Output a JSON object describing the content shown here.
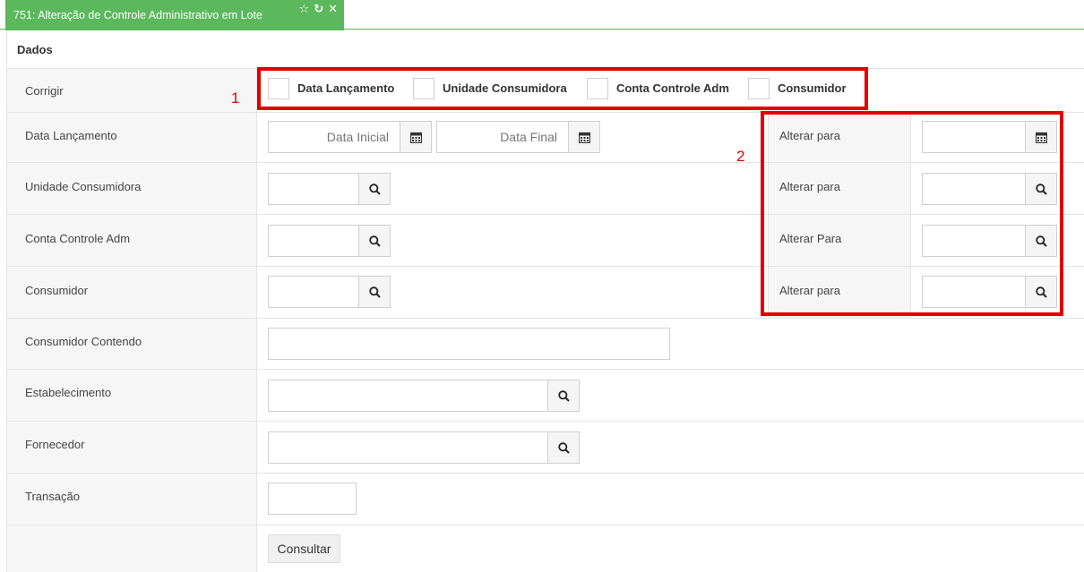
{
  "tab": {
    "title": "751: Alteração de Controle Administrativo em Lote"
  },
  "panel": {
    "title": "Dados"
  },
  "corrigir": {
    "label": "Corrigir",
    "options": [
      "Data Lançamento",
      "Unidade Consumidora",
      "Conta Controle Adm",
      "Consumidor"
    ]
  },
  "rows": {
    "data_lancamento": {
      "label": "Data Lançamento",
      "inicial_placeholder": "Data Inicial",
      "final_placeholder": "Data Final",
      "alter_label": "Alterar para"
    },
    "unidade_consumidora": {
      "label": "Unidade Consumidora",
      "alter_label": "Alterar para"
    },
    "conta_controle_adm": {
      "label": "Conta Controle Adm",
      "alter_label": "Alterar Para"
    },
    "consumidor": {
      "label": "Consumidor",
      "alter_label": "Alterar para"
    },
    "consumidor_contendo": {
      "label": "Consumidor Contendo"
    },
    "estabelecimento": {
      "label": "Estabelecimento"
    },
    "fornecedor": {
      "label": "Fornecedor"
    },
    "transacao": {
      "label": "Transação"
    }
  },
  "actions": {
    "consultar_label": "Consultar"
  },
  "annotations": {
    "box1": "1",
    "box2": "2"
  },
  "colors": {
    "accent": "#5cb85c",
    "annotation": "#e00000"
  },
  "icons": [
    "star-icon",
    "refresh-icon",
    "close-icon",
    "calendar-icon",
    "search-icon"
  ]
}
